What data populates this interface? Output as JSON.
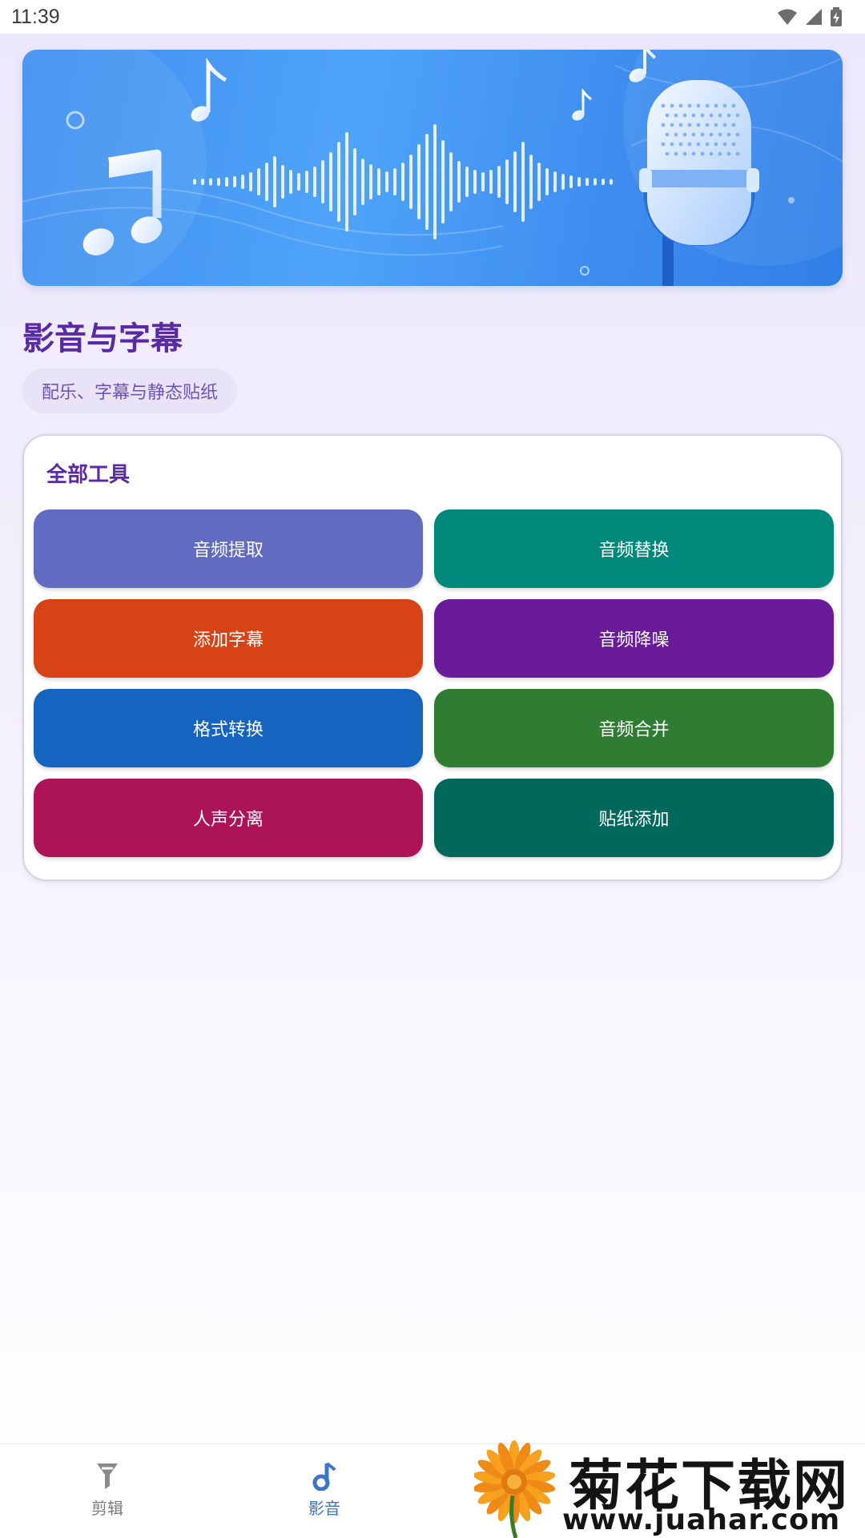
{
  "status_bar": {
    "time": "11:39",
    "icons": [
      "wifi-icon",
      "cell-signal-icon",
      "battery-charging-icon"
    ]
  },
  "banner": {
    "icons": [
      "music-note-icon",
      "sound-wave-icon",
      "microphone-icon"
    ],
    "color": "#4a9cf6"
  },
  "header": {
    "title": "影音与字幕",
    "subtitle": "配乐、字幕与静态贴纸"
  },
  "tools": {
    "heading": "全部工具",
    "items": [
      {
        "label": "音频提取",
        "color": "#616bc0"
      },
      {
        "label": "音频替换",
        "color": "#00897b"
      },
      {
        "label": "添加字幕",
        "color": "#d84315"
      },
      {
        "label": "音频降噪",
        "color": "#6a1b9a"
      },
      {
        "label": "格式转换",
        "color": "#1565c0"
      },
      {
        "label": "音频合并",
        "color": "#2e7d32"
      },
      {
        "label": "人声分离",
        "color": "#ad1457"
      },
      {
        "label": "贴纸添加",
        "color": "#00695c"
      }
    ]
  },
  "bottom_nav": {
    "items": [
      {
        "label": "剪辑",
        "icon": "filter-funnel-icon",
        "active": false
      },
      {
        "label": "影音",
        "icon": "music-note-icon",
        "active": true
      }
    ],
    "active_color": "#3b74c9"
  },
  "watermark": {
    "title": "菊花下载网",
    "url": "www.juahar.com"
  }
}
